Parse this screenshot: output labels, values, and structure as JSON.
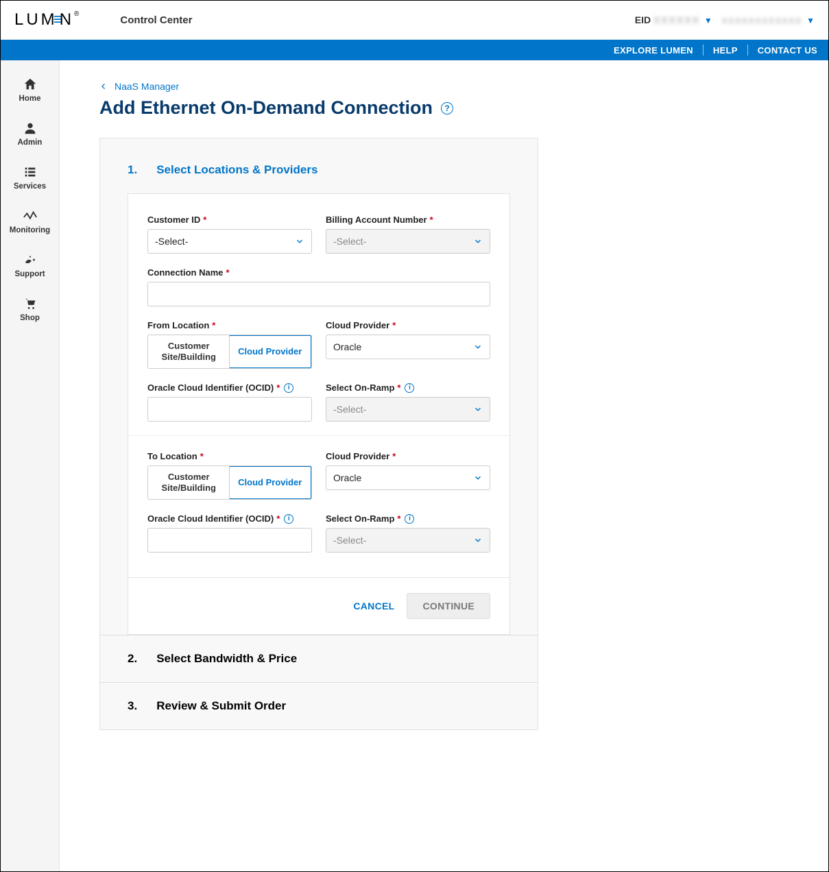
{
  "header": {
    "logo_text": "LUMEN",
    "app_title": "Control Center",
    "eid_label": "EID",
    "eid_value": "XXXXXX",
    "account_value": "xxxxxxxxxxxx"
  },
  "topnav": {
    "explore": "EXPLORE LUMEN",
    "help": "HELP",
    "contact": "CONTACT US"
  },
  "sidebar": [
    {
      "icon": "home",
      "label": "Home"
    },
    {
      "icon": "admin",
      "label": "Admin"
    },
    {
      "icon": "services",
      "label": "Services"
    },
    {
      "icon": "monitoring",
      "label": "Monitoring"
    },
    {
      "icon": "support",
      "label": "Support"
    },
    {
      "icon": "shop",
      "label": "Shop"
    }
  ],
  "breadcrumb": {
    "label": "NaaS Manager"
  },
  "page_title": "Add Ethernet On-Demand Connection",
  "steps": {
    "s1": {
      "num": "1.",
      "title": "Select Locations & Providers"
    },
    "s2": {
      "num": "2.",
      "title": "Select Bandwidth & Price"
    },
    "s3": {
      "num": "3.",
      "title": "Review & Submit Order"
    }
  },
  "form": {
    "customer_id": {
      "label": "Customer ID",
      "value": "-Select-"
    },
    "billing": {
      "label": "Billing Account Number",
      "value": "-Select-"
    },
    "conn_name": {
      "label": "Connection Name",
      "value": ""
    },
    "from_location": {
      "label": "From Location",
      "options": {
        "a": "Customer Site/Building",
        "b": "Cloud Provider"
      },
      "selected": "b"
    },
    "cloud_provider_from": {
      "label": "Cloud Provider",
      "value": "Oracle"
    },
    "ocid_from": {
      "label": "Oracle Cloud Identifier (OCID)",
      "value": ""
    },
    "onramp_from": {
      "label": "Select On-Ramp",
      "value": "-Select-"
    },
    "to_location": {
      "label": "To Location",
      "options": {
        "a": "Customer Site/Building",
        "b": "Cloud Provider"
      },
      "selected": "b"
    },
    "cloud_provider_to": {
      "label": "Cloud Provider",
      "value": "Oracle"
    },
    "ocid_to": {
      "label": "Oracle Cloud Identifier (OCID)",
      "value": ""
    },
    "onramp_to": {
      "label": "Select On-Ramp",
      "value": "-Select-"
    },
    "cancel": "CANCEL",
    "continue": "CONTINUE"
  }
}
